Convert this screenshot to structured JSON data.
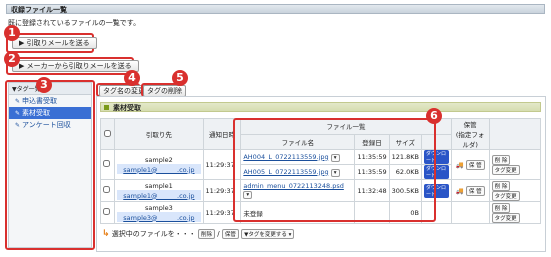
{
  "page": {
    "title": "収録ファイル一覧",
    "description": "既に登録されているファイルの一覧です。"
  },
  "buttons": {
    "send_retrieval_mail": "引取りメールを送る",
    "send_retrieval_mail_from_maker": "メーカーから引取りメールを送る",
    "tag_rename": "タグ名の変更",
    "tag_delete": "タグの削除"
  },
  "callouts": [
    "1",
    "2",
    "3",
    "4",
    "5",
    "6"
  ],
  "sidebar": {
    "header": "▼タグ一覧",
    "items": [
      {
        "label": "申込書受取",
        "selected": false
      },
      {
        "label": "素材受取",
        "selected": true
      },
      {
        "label": "アンケート回収",
        "selected": false
      }
    ]
  },
  "section": {
    "title": "素材受取"
  },
  "table": {
    "headers": {
      "recipient": "引取り先",
      "notified": "通知日時",
      "files": "ファイル一覧",
      "filename": "ファイル名",
      "registered": "登録日",
      "size": "サイズ",
      "storage": "保管\n(指定フォルダ)"
    },
    "rows": [
      {
        "name": "sample2",
        "email": "sample1@　　　.co.jp",
        "time": "11:29:37",
        "files": [
          {
            "name": "AH004_L_0722113559.jpg",
            "date": "11:35:59",
            "size": "121.8KB"
          },
          {
            "name": "AH005_L_0722113559.jpg",
            "date": "11:35:59",
            "size": "62.0KB"
          }
        ]
      },
      {
        "name": "sample1",
        "email": "sample1@　　　.co.jp",
        "time": "11:29:37",
        "files": [
          {
            "name": "admin_menu_0722113248.psd",
            "date": "11:32:48",
            "size": "300.5KB"
          }
        ]
      },
      {
        "name": "sample3",
        "email": "sample3@　　　.co.jp",
        "time": "11:29:37",
        "files": [
          {
            "name": "未登録",
            "date": "",
            "size": "0B"
          }
        ]
      }
    ],
    "actions": {
      "download": "ダウンロード",
      "store": "保 管",
      "delete": "削 除",
      "tag_change": "タグ変更"
    }
  },
  "bottom": {
    "text": "選択中のファイルを・・・",
    "delete": "削除",
    "store": "保管",
    "tag_change_select": "▼タグを変更する ▾"
  }
}
